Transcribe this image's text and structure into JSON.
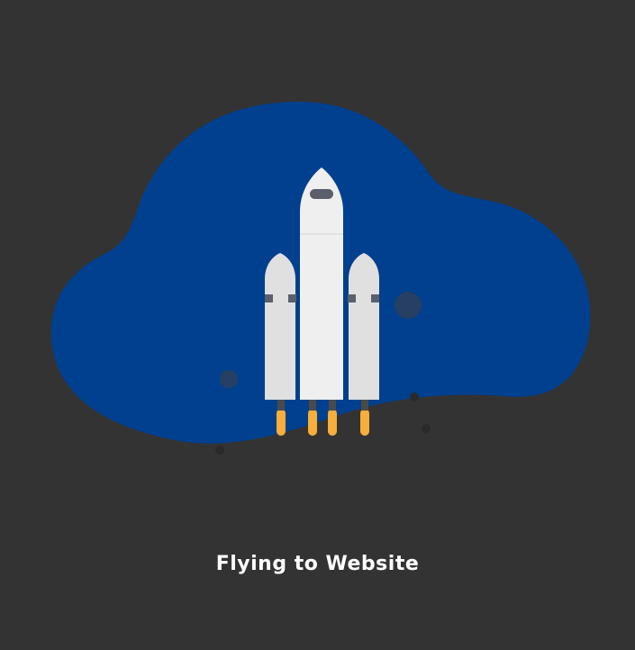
{
  "loader": {
    "caption": "Flying to Website",
    "illustration_icon": "rocket-launch-icon"
  },
  "colors": {
    "background": "#333333",
    "blob": "#00408f",
    "rocket_body": "#efefef",
    "booster_body": "#e0e0e0",
    "window": "#5a5f6b",
    "flame": "#f7ae3b",
    "nozzle": "#4a4a4a",
    "bubble": "#263f63"
  }
}
